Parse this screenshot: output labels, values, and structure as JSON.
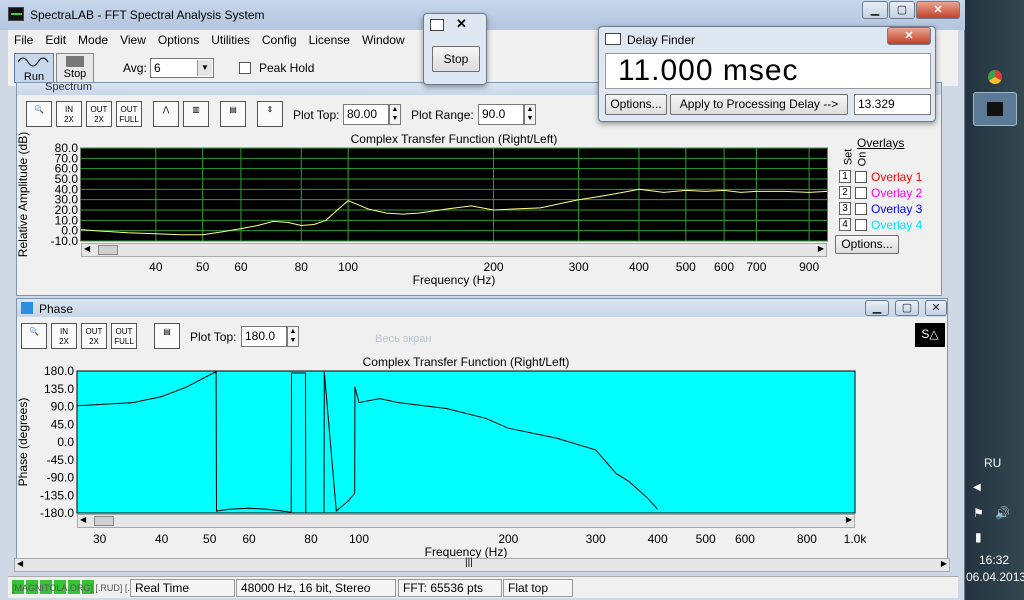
{
  "app": {
    "title": "SpectraLAB - FFT Spectral Analysis System"
  },
  "menu": [
    "File",
    "Edit",
    "Mode",
    "View",
    "Options",
    "Utilities",
    "Config",
    "License",
    "Window"
  ],
  "toolbar": {
    "run": "Run",
    "stop": "Stop",
    "avg_label": "Avg:",
    "avg_value": "6",
    "peak_hold": "Peak Hold"
  },
  "stop_window": {
    "button": "Stop"
  },
  "delay_finder": {
    "title": "Delay Finder",
    "value": "11.000 msec",
    "options": "Options...",
    "apply": "Apply to Processing Delay -->",
    "result": "13.329"
  },
  "spectrum": {
    "title": "Spectrum",
    "plot_top_label": "Plot Top:",
    "plot_top": "80.00",
    "plot_range_label": "Plot Range:",
    "plot_range": "90.0",
    "overlays_label": "Overlays",
    "set_label": "Set",
    "on_label": "On",
    "overlays": [
      {
        "n": "1",
        "name": "Overlay 1",
        "color": "#ff0000"
      },
      {
        "n": "2",
        "name": "Overlay 2",
        "color": "#ff00ff"
      },
      {
        "n": "3",
        "name": "Overlay 3",
        "color": "#0000ff"
      },
      {
        "n": "4",
        "name": "Overlay 4",
        "color": "#00e5ff"
      }
    ],
    "options": "Options..."
  },
  "phase": {
    "title": "Phase",
    "plot_top_label": "Plot Top:",
    "plot_top": "180.0",
    "ghost": "Весь экран"
  },
  "chart_data": [
    {
      "type": "line",
      "title": "Complex Transfer Function (Right/Left)",
      "xlabel": "Frequency (Hz)",
      "ylabel": "Relative Amplitude (dB)",
      "x_scale": "log",
      "xlim": [
        28,
        980
      ],
      "ylim": [
        -10,
        80
      ],
      "yticks": [
        "80.0",
        "70.0",
        "60.0",
        "50.0",
        "40.0",
        "30.0",
        "20.0",
        "10.0",
        "0.0",
        "-10.0"
      ],
      "xticks": [
        "40",
        "50",
        "60",
        "80",
        "100",
        "200",
        "300",
        "400",
        "500",
        "600",
        "700",
        "900"
      ],
      "background": "#000000",
      "line_color": "#ffff80",
      "grid": true,
      "series": [
        {
          "x": [
            28,
            30,
            35,
            40,
            45,
            50,
            55,
            60,
            65,
            70,
            75,
            80,
            85,
            90,
            95,
            100,
            105,
            110,
            120,
            130,
            140,
            150,
            160,
            180,
            200,
            220,
            250,
            280,
            300,
            330,
            350,
            380,
            400,
            450,
            500,
            550,
            600,
            650,
            700,
            800,
            900,
            980
          ],
          "y": [
            1,
            0,
            -2,
            -3,
            -4,
            -4,
            -1,
            2,
            5,
            9,
            8,
            5,
            6,
            10,
            20,
            29,
            25,
            21,
            17,
            16,
            17,
            19,
            21,
            24,
            20,
            21,
            22,
            27,
            30,
            33,
            35,
            38,
            40,
            37,
            39,
            38,
            39,
            37,
            38,
            38,
            37,
            38
          ]
        }
      ]
    },
    {
      "type": "line",
      "title": "Complex Transfer Function (Right/Left)",
      "xlabel": "Frequency (Hz)",
      "ylabel": "Phase (degrees)",
      "x_scale": "log",
      "xlim": [
        27,
        1000
      ],
      "ylim": [
        -180,
        180
      ],
      "yticks": [
        "180.0",
        "135.0",
        "90.0",
        "45.0",
        "0.0",
        "-45.0",
        "-90.0",
        "-135.0",
        "-180.0"
      ],
      "xticks": [
        "30",
        "40",
        "50",
        "60",
        "80",
        "100",
        "200",
        "300",
        "400",
        "500",
        "600",
        "800",
        "1.0k"
      ],
      "background": "#00ffff",
      "line_color": "#000000",
      "grid": false,
      "series": [
        {
          "x": [
            27,
            30,
            35,
            40,
            45,
            50,
            51.5,
            51.6,
            55,
            60,
            65,
            70,
            73,
            73.1,
            78,
            78.1,
            85,
            85.1,
            90,
            95,
            98,
            98.1,
            100,
            110,
            120,
            150,
            180,
            200,
            250,
            300,
            330,
            350,
            380,
            400
          ],
          "y": [
            92,
            95,
            100,
            115,
            140,
            170,
            178,
            -175,
            -170,
            -168,
            -170,
            -175,
            -178,
            175,
            175,
            -180,
            -180,
            178,
            -175,
            -150,
            -130,
            140,
            100,
            110,
            100,
            85,
            60,
            35,
            10,
            -20,
            -80,
            -100,
            -140,
            -170
          ]
        }
      ]
    }
  ],
  "status": {
    "mode": "Real Time",
    "format": "48000 Hz, 16 bit, Stereo",
    "fft": "FFT: 65536 pts",
    "window": "Flat top",
    "watermark": "[MAGNITOLA.ORG] [.RUD] [.NET]"
  },
  "taskbar": {
    "lang": "RU",
    "time": "16:32",
    "date": "06.04.2013"
  }
}
